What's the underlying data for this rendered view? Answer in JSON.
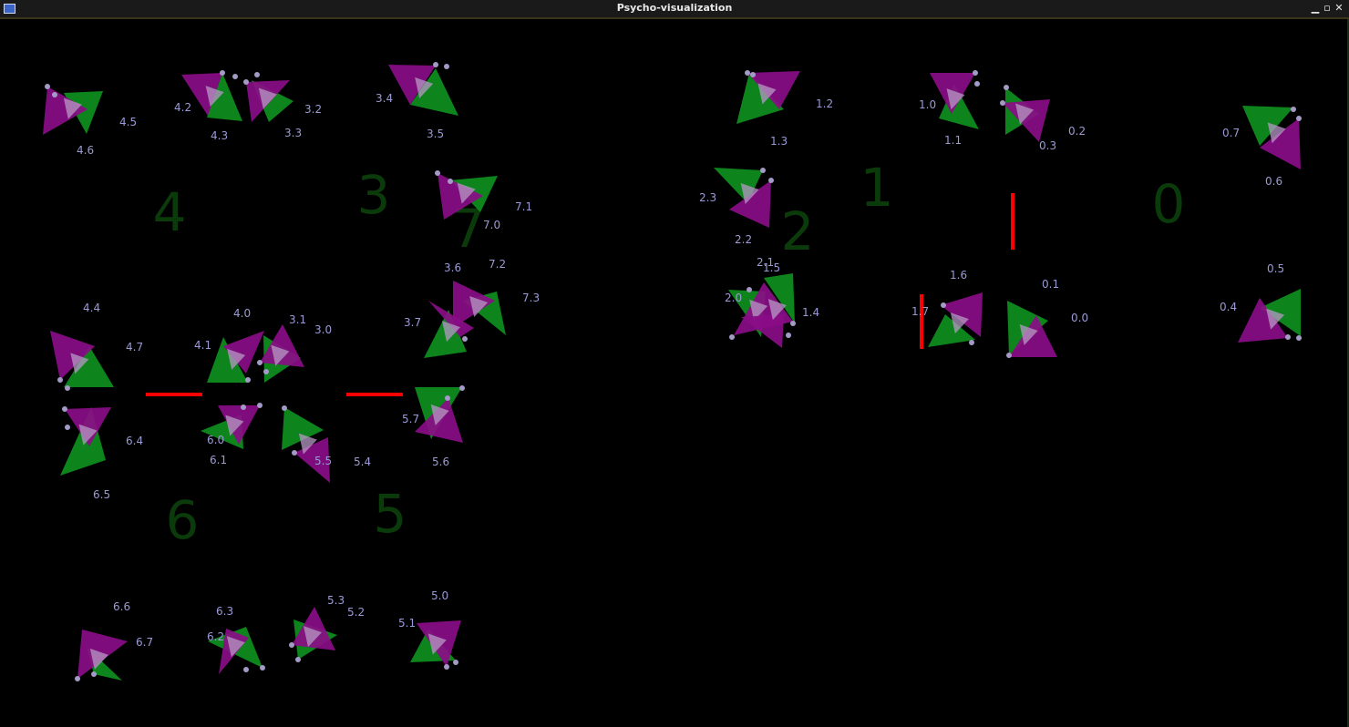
{
  "window": {
    "title": "Psycho-visualization",
    "buttons": {
      "minimize": "▁",
      "maximize": "▫",
      "close": "✕"
    }
  },
  "colors": {
    "background": "#000000",
    "green": "#0e8f1e",
    "magenta": "#8a0d87",
    "overlap": "#b79ac6",
    "vertex": "#a39ac6",
    "label": "#9a9ad6",
    "cluster_number": "#0b3a0b",
    "link": "#ff0000"
  },
  "clusters": [
    {
      "label": "0"
    },
    {
      "label": "1"
    },
    {
      "label": "2"
    },
    {
      "label": "3"
    },
    {
      "label": "4"
    },
    {
      "label": "5"
    },
    {
      "label": "6"
    },
    {
      "label": "7"
    }
  ],
  "nodes": [
    {
      "label": "0.0"
    },
    {
      "label": "0.1"
    },
    {
      "label": "0.2"
    },
    {
      "label": "0.3"
    },
    {
      "label": "0.4"
    },
    {
      "label": "0.5"
    },
    {
      "label": "0.6"
    },
    {
      "label": "0.7"
    },
    {
      "label": "1.0"
    },
    {
      "label": "1.1"
    },
    {
      "label": "1.2"
    },
    {
      "label": "1.3"
    },
    {
      "label": "1.4"
    },
    {
      "label": "1.5"
    },
    {
      "label": "1.6"
    },
    {
      "label": "1.7"
    },
    {
      "label": "2.0"
    },
    {
      "label": "2.1"
    },
    {
      "label": "2.2"
    },
    {
      "label": "2.3"
    },
    {
      "label": "3.0"
    },
    {
      "label": "3.1"
    },
    {
      "label": "3.2"
    },
    {
      "label": "3.3"
    },
    {
      "label": "3.4"
    },
    {
      "label": "3.5"
    },
    {
      "label": "3.6"
    },
    {
      "label": "3.7"
    },
    {
      "label": "4.0"
    },
    {
      "label": "4.1"
    },
    {
      "label": "4.2"
    },
    {
      "label": "4.3"
    },
    {
      "label": "4.4"
    },
    {
      "label": "4.5"
    },
    {
      "label": "4.6"
    },
    {
      "label": "4.7"
    },
    {
      "label": "5.0"
    },
    {
      "label": "5.1"
    },
    {
      "label": "5.2"
    },
    {
      "label": "5.3"
    },
    {
      "label": "5.4"
    },
    {
      "label": "5.5"
    },
    {
      "label": "5.6"
    },
    {
      "label": "5.7"
    },
    {
      "label": "6.0"
    },
    {
      "label": "6.1"
    },
    {
      "label": "6.2"
    },
    {
      "label": "6.3"
    },
    {
      "label": "6.4"
    },
    {
      "label": "6.5"
    },
    {
      "label": "6.6"
    },
    {
      "label": "6.7"
    },
    {
      "label": "7.0"
    },
    {
      "label": "7.1"
    },
    {
      "label": "7.2"
    },
    {
      "label": "7.3"
    }
  ]
}
